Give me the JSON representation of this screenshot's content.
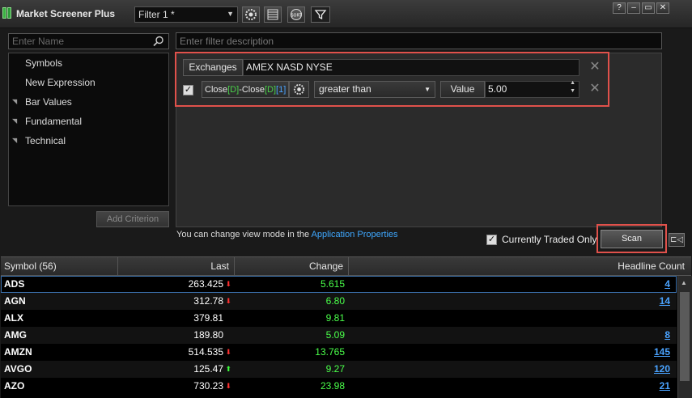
{
  "title": "Market Screener Plus",
  "filter_select": {
    "value": "Filter 1 *"
  },
  "window_buttons": {
    "help": "?",
    "minimize": "–",
    "restore": "▭",
    "close": "✕"
  },
  "toolbar_icons": [
    "settings-icon",
    "columns-icon",
    "sort-icon",
    "funnel-icon"
  ],
  "search": {
    "placeholder": "Enter Name"
  },
  "tree": [
    {
      "label": "Symbols",
      "expandable": false
    },
    {
      "label": "New Expression",
      "expandable": false
    },
    {
      "label": "Bar Values",
      "expandable": true
    },
    {
      "label": "Fundamental",
      "expandable": true
    },
    {
      "label": "Technical",
      "expandable": true
    }
  ],
  "add_criterion": "Add Criterion",
  "filter_description": {
    "placeholder": "Enter filter description"
  },
  "criteria": {
    "exchanges_label": "Exchanges",
    "exchanges_value": "AMEX NASD NYSE",
    "formula": {
      "a": "Close",
      "a_p": "[D]",
      "dash": "-",
      "b": "Close",
      "b_p": "[D]",
      "b_off": "[1]"
    },
    "operator": "greater than",
    "value_label": "Value",
    "value": "5.00"
  },
  "view_mode_text": "You can change view mode in the ",
  "view_mode_link": "Application Properties",
  "currently_traded_only": "Currently Traded Only",
  "scan": "Scan",
  "table": {
    "headers": {
      "symbol": "Symbol (56)",
      "last": "Last",
      "change": "Change",
      "headline": "Headline Count"
    },
    "rows": [
      {
        "symbol": "ADS",
        "last": "263.425",
        "dir": "down",
        "change": "5.615",
        "headline": "4"
      },
      {
        "symbol": "AGN",
        "last": "312.78",
        "dir": "down",
        "change": "6.80",
        "headline": "14"
      },
      {
        "symbol": "ALX",
        "last": "379.81",
        "dir": "",
        "change": "9.81",
        "headline": ""
      },
      {
        "symbol": "AMG",
        "last": "189.80",
        "dir": "",
        "change": "5.09",
        "headline": "8"
      },
      {
        "symbol": "AMZN",
        "last": "514.535",
        "dir": "down",
        "change": "13.765",
        "headline": "145"
      },
      {
        "symbol": "AVGO",
        "last": "125.47",
        "dir": "up",
        "change": "9.27",
        "headline": "120"
      },
      {
        "symbol": "AZO",
        "last": "730.23",
        "dir": "down",
        "change": "23.98",
        "headline": "21"
      }
    ]
  },
  "colors": {
    "accent_red": "#e0514b",
    "positive": "#4aff4a",
    "link": "#4aa3ff",
    "down_arrow": "#ff3030",
    "up_arrow": "#3cff3c"
  }
}
